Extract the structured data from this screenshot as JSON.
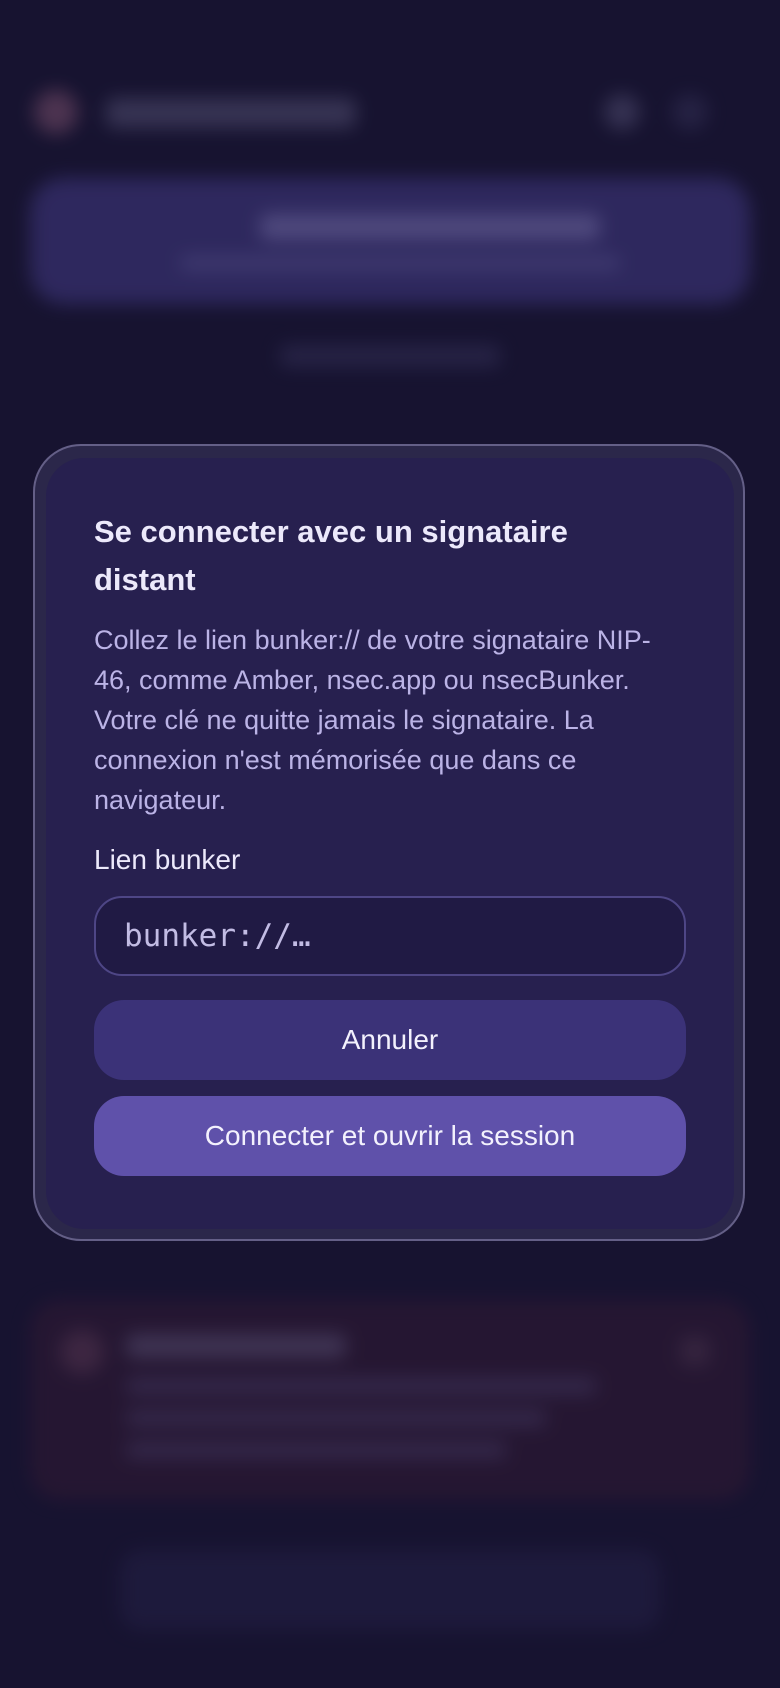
{
  "dialog": {
    "title": "Se connecter avec un signataire distant",
    "description": "Collez le lien bunker:// de votre signataire NIP-46, comme Amber, nsec.app ou nsecBunker. Votre clé ne quitte jamais le signataire. La connexion n'est mémorisée que dans ce navigateur.",
    "field_label": "Lien bunker",
    "input": {
      "value": "",
      "placeholder": "bunker://…"
    },
    "cancel_label": "Annuler",
    "connect_label": "Connecter et ouvrir la session"
  },
  "colors": {
    "background": "#1c1838",
    "dialog": "#27204f",
    "cancel_button": "#3b3278",
    "primary_button": "#5f51aa",
    "text_primary": "#ece9fb",
    "text_secondary": "#bbb3e6"
  }
}
